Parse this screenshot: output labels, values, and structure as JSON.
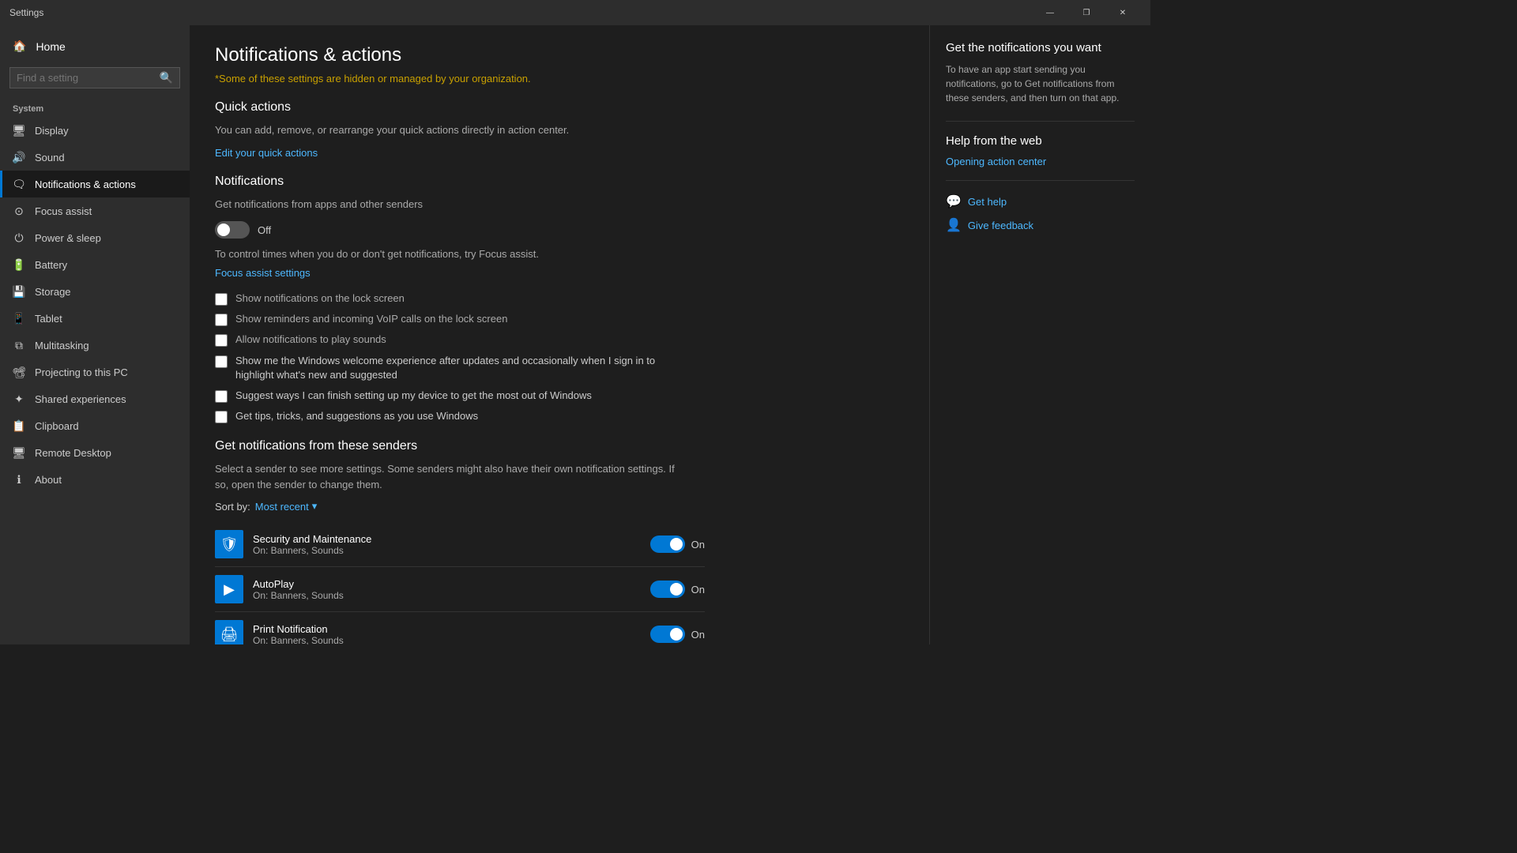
{
  "titlebar": {
    "title": "Settings",
    "minimize": "—",
    "restore": "❐",
    "close": "✕"
  },
  "sidebar": {
    "home_label": "Home",
    "search_placeholder": "Find a setting",
    "system_label": "System",
    "nav_items": [
      {
        "id": "display",
        "label": "Display",
        "icon": "🖥"
      },
      {
        "id": "sound",
        "label": "Sound",
        "icon": "🔊"
      },
      {
        "id": "notifications",
        "label": "Notifications & actions",
        "icon": "🗨",
        "active": true
      },
      {
        "id": "focus",
        "label": "Focus assist",
        "icon": "⊙"
      },
      {
        "id": "power",
        "label": "Power & sleep",
        "icon": "⏻"
      },
      {
        "id": "battery",
        "label": "Battery",
        "icon": "🔋"
      },
      {
        "id": "storage",
        "label": "Storage",
        "icon": "💾"
      },
      {
        "id": "tablet",
        "label": "Tablet",
        "icon": "📱"
      },
      {
        "id": "multitasking",
        "label": "Multitasking",
        "icon": "⧉"
      },
      {
        "id": "projecting",
        "label": "Projecting to this PC",
        "icon": "📽"
      },
      {
        "id": "shared",
        "label": "Shared experiences",
        "icon": "✦"
      },
      {
        "id": "clipboard",
        "label": "Clipboard",
        "icon": "📋"
      },
      {
        "id": "remote",
        "label": "Remote Desktop",
        "icon": "🖥"
      },
      {
        "id": "about",
        "label": "About",
        "icon": "ℹ"
      }
    ]
  },
  "content": {
    "page_title": "Notifications & actions",
    "org_notice": "*Some of these settings are hidden or managed by your organization.",
    "quick_actions": {
      "title": "Quick actions",
      "desc": "You can add, remove, or rearrange your quick actions directly in action center.",
      "edit_link": "Edit your quick actions"
    },
    "notifications": {
      "title": "Notifications",
      "get_notifications_label": "Get notifications from apps and other senders",
      "toggle_state": "off",
      "toggle_label": "Off",
      "focus_text": "To control times when you do or don't get notifications, try Focus assist.",
      "focus_link": "Focus assist settings",
      "checkboxes": [
        {
          "id": "lock_screen",
          "label": "Show notifications on the lock screen",
          "checked": false,
          "enabled": false
        },
        {
          "id": "voip",
          "label": "Show reminders and incoming VoIP calls on the lock screen",
          "checked": false,
          "enabled": false
        },
        {
          "id": "sounds",
          "label": "Allow notifications to play sounds",
          "checked": false,
          "enabled": false
        },
        {
          "id": "welcome",
          "label": "Show me the Windows welcome experience after updates and occasionally when I sign in to highlight what's new and suggested",
          "checked": false,
          "enabled": true
        },
        {
          "id": "suggest",
          "label": "Suggest ways I can finish setting up my device to get the most out of Windows",
          "checked": false,
          "enabled": true
        },
        {
          "id": "tips",
          "label": "Get tips, tricks, and suggestions as you use Windows",
          "checked": false,
          "enabled": true
        }
      ]
    },
    "senders": {
      "title": "Get notifications from these senders",
      "desc": "Select a sender to see more settings. Some senders might also have their own notification settings. If so, open the sender to change them.",
      "sort_label": "Sort by:",
      "sort_value": "Most recent",
      "items": [
        {
          "name": "Security and Maintenance",
          "sub": "On: Banners, Sounds",
          "toggle": "on",
          "label": "On"
        },
        {
          "name": "AutoPlay",
          "sub": "On: Banners, Sounds",
          "toggle": "on",
          "label": "On"
        },
        {
          "name": "Print Notification",
          "sub": "On: Banners, Sounds",
          "toggle": "on",
          "label": "On"
        }
      ]
    }
  },
  "right_panel": {
    "get_notifications_title": "Get the notifications you want",
    "get_notifications_text": "To have an app start sending you notifications, go to Get notifications from these senders, and then turn on that app.",
    "help_from_web_title": "Help from the web",
    "opening_action_center_link": "Opening action center",
    "get_help_label": "Get help",
    "give_feedback_label": "Give feedback"
  }
}
